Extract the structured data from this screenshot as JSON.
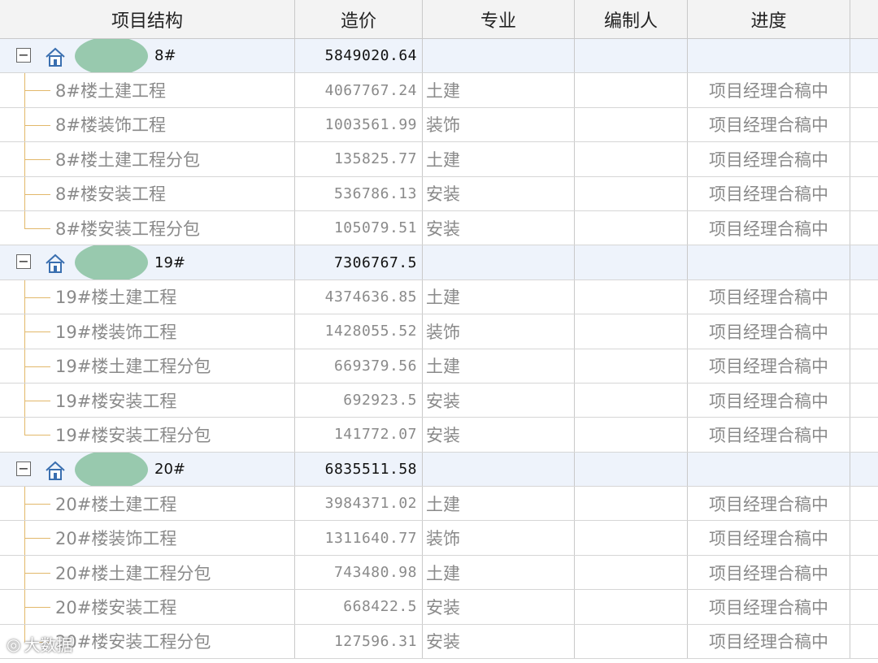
{
  "columns": [
    "项目结构",
    "造价",
    "专业",
    "编制人",
    "进度"
  ],
  "groups": [
    {
      "name": "8#",
      "cost": "5849020.64",
      "children": [
        {
          "name": "8#楼土建工程",
          "cost": "4067767.24",
          "major": "土建",
          "status": "项目经理合稿中"
        },
        {
          "name": "8#楼装饰工程",
          "cost": "1003561.99",
          "major": "装饰",
          "status": "项目经理合稿中"
        },
        {
          "name": "8#楼土建工程分包",
          "cost": "135825.77",
          "major": "土建",
          "status": "项目经理合稿中"
        },
        {
          "name": "8#楼安装工程",
          "cost": "536786.13",
          "major": "安装",
          "status": "项目经理合稿中"
        },
        {
          "name": "8#楼安装工程分包",
          "cost": "105079.51",
          "major": "安装",
          "status": "项目经理合稿中"
        }
      ]
    },
    {
      "name": "19#",
      "cost": "7306767.5",
      "children": [
        {
          "name": "19#楼土建工程",
          "cost": "4374636.85",
          "major": "土建",
          "status": "项目经理合稿中"
        },
        {
          "name": "19#楼装饰工程",
          "cost": "1428055.52",
          "major": "装饰",
          "status": "项目经理合稿中"
        },
        {
          "name": "19#楼土建工程分包",
          "cost": "669379.56",
          "major": "土建",
          "status": "项目经理合稿中"
        },
        {
          "name": "19#楼安装工程",
          "cost": "692923.5",
          "major": "安装",
          "status": "项目经理合稿中"
        },
        {
          "name": "19#楼安装工程分包",
          "cost": "141772.07",
          "major": "安装",
          "status": "项目经理合稿中"
        }
      ]
    },
    {
      "name": "20#",
      "cost": "6835511.58",
      "children": [
        {
          "name": "20#楼土建工程",
          "cost": "3984371.02",
          "major": "土建",
          "status": "项目经理合稿中"
        },
        {
          "name": "20#楼装饰工程",
          "cost": "1311640.77",
          "major": "装饰",
          "status": "项目经理合稿中"
        },
        {
          "name": "20#楼土建工程分包",
          "cost": "743480.98",
          "major": "土建",
          "status": "项目经理合稿中"
        },
        {
          "name": "20#楼安装工程",
          "cost": "668422.5",
          "major": "安装",
          "status": "项目经理合稿中"
        },
        {
          "name": "20#楼安装工程分包",
          "cost": "127596.31",
          "major": "安装",
          "status": "项目经理合稿中"
        }
      ]
    }
  ],
  "watermark": "大数据",
  "colors": {
    "group_row_bg": "#eef3fb",
    "header_bg": "#f3f3f3",
    "tree_line": "#e2b86a",
    "redaction_blob": "#98c9ae"
  }
}
